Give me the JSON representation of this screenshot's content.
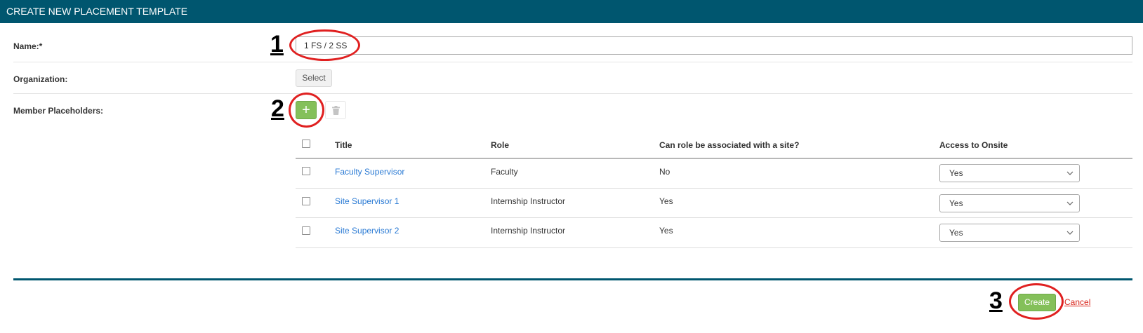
{
  "header": {
    "title": "CREATE NEW PLACEMENT TEMPLATE"
  },
  "form": {
    "name_label": "Name:*",
    "name_value": "1 FS / 2 SS",
    "organization_label": "Organization:",
    "select_button": "Select",
    "member_label": "Member Placeholders:",
    "add_icon": "plus-icon",
    "delete_icon": "trash-icon"
  },
  "table": {
    "columns": [
      "Title",
      "Role",
      "Can role be associated with a site?",
      "Access to Onsite"
    ],
    "rows": [
      {
        "title": "Faculty Supervisor",
        "role": "Faculty",
        "site": "No",
        "access": "Yes"
      },
      {
        "title": "Site Supervisor 1",
        "role": "Internship Instructor",
        "site": "Yes",
        "access": "Yes"
      },
      {
        "title": "Site Supervisor 2",
        "role": "Internship Instructor",
        "site": "Yes",
        "access": "Yes"
      }
    ]
  },
  "footer": {
    "create_label": "Create",
    "cancel_label": "Cancel"
  },
  "annotations": {
    "step1": "1",
    "step2": "2",
    "step3": "3"
  },
  "colors": {
    "header": "#00566f",
    "accent_green": "#84c05a",
    "link_blue": "#2a7ad4",
    "cancel_red": "#d9261c",
    "annotation_red": "#e02020"
  }
}
